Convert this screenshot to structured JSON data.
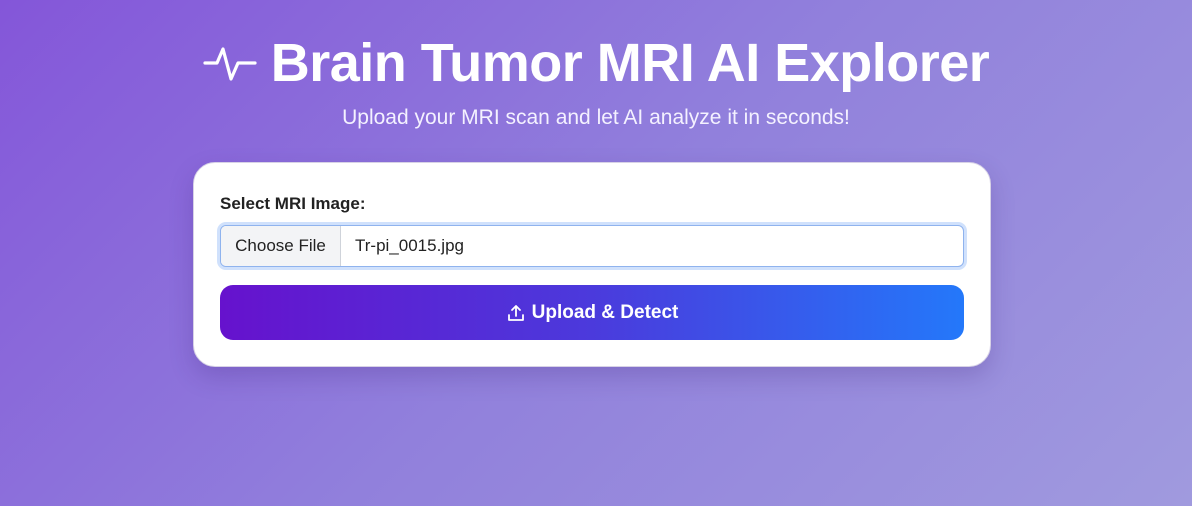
{
  "header": {
    "icon": "pulse-icon",
    "title": "Brain Tumor MRI AI Explorer",
    "subtitle": "Upload your MRI scan and let AI analyze it in seconds!"
  },
  "form": {
    "field_label": "Select MRI Image:",
    "choose_file_label": "Choose File",
    "selected_file": "Tr-pi_0015.jpg",
    "submit_icon": "upload-icon",
    "submit_label": "Upload & Detect"
  },
  "colors": {
    "background_start": "#8456d9",
    "background_end": "#a09ade",
    "button_gradient_start": "#6612cd",
    "button_gradient_end": "#2478fa",
    "card_background": "#ffffff"
  }
}
